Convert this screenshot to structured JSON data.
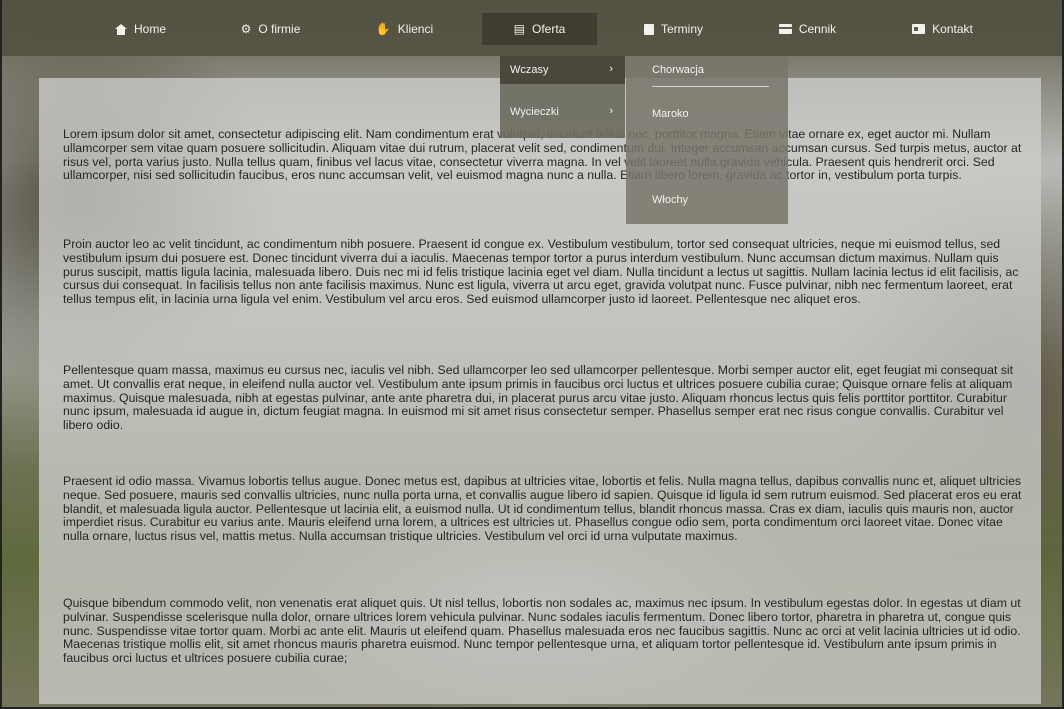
{
  "nav": {
    "items": [
      {
        "label": "Home",
        "icon": "home-icon"
      },
      {
        "label": "O firmie",
        "icon": "cogs-icon"
      },
      {
        "label": "Klienci",
        "icon": "handshake-icon"
      },
      {
        "label": "Oferta",
        "icon": "map-icon"
      },
      {
        "label": "Terminy",
        "icon": "calendar-icon"
      },
      {
        "label": "Cennik",
        "icon": "credit-card-icon"
      },
      {
        "label": "Kontakt",
        "icon": "id-card-icon"
      }
    ],
    "active": "Oferta"
  },
  "dropdown": {
    "level1": [
      {
        "label": "Wczasy",
        "arrow": "›",
        "selected": true
      },
      {
        "label": "Wycieczki",
        "arrow": "›",
        "selected": false
      }
    ],
    "level2": [
      "Chorwacja",
      "Maroko",
      "Włochy"
    ]
  },
  "content": {
    "paragraphs": [
      "Lorem ipsum dolor sit amet, consectetur adipiscing elit. Nam condimentum erat volutpat, tincidunt tellus nec, porttitor magna. Etiam vitae ornare ex, eget auctor mi. Nullam ullamcorper sem vitae quam posuere sollicitudin. Aliquam vitae dui rutrum, placerat velit sed, condimentum dui. Integer accumsan accumsan cursus. Sed turpis metus, auctor at risus vel, porta varius justo. Nulla tellus quam, finibus vel lacus vitae, consectetur viverra magna. In vel velit laoreet nulla gravida vehicula. Praesent quis hendrerit orci. Sed ullamcorper, nisi sed sollicitudin faucibus, eros nunc accumsan velit, vel euismod magna nunc a nulla. Etiam libero lorem, gravida ac tortor in, vestibulum porta turpis.",
      "Proin auctor leo ac velit tincidunt, ac condimentum nibh posuere. Praesent id congue ex. Vestibulum vestibulum, tortor sed consequat ultricies, neque mi euismod tellus, sed vestibulum ipsum dui posuere est. Donec tincidunt viverra dui a iaculis. Maecenas tempor tortor a purus interdum vestibulum. Nunc accumsan dictum maximus. Nullam quis purus suscipit, mattis ligula lacinia, malesuada libero. Duis nec mi id felis tristique lacinia eget vel diam. Nulla tincidunt a lectus ut sagittis. Nullam lacinia lectus id elit facilisis, ac cursus dui consequat. In facilisis tellus non ante facilisis maximus. Nunc est ligula, viverra ut arcu eget, gravida volutpat nunc. Fusce pulvinar, nibh nec fermentum laoreet, erat tellus tempus elit, in lacinia urna ligula vel enim. Vestibulum vel arcu eros. Sed euismod ullamcorper justo id laoreet. Pellentesque nec aliquet eros.",
      "Pellentesque quam massa, maximus eu cursus nec, iaculis vel nibh. Sed ullamcorper leo sed ullamcorper pellentesque. Morbi semper auctor elit, eget feugiat mi consequat sit amet. Ut convallis erat neque, in eleifend nulla auctor vel. Vestibulum ante ipsum primis in faucibus orci luctus et ultrices posuere cubilia curae; Quisque ornare felis at aliquam maximus. Quisque malesuada, nibh at egestas pulvinar, ante ante pharetra dui, in placerat purus arcu vitae justo. Aliquam rhoncus lectus quis felis porttitor porttitor. Curabitur nunc ipsum, malesuada id augue in, dictum feugiat magna. In euismod mi sit amet risus consectetur semper. Phasellus semper erat nec risus congue convallis. Curabitur vel libero odio.",
      "Praesent id odio massa. Vivamus lobortis tellus augue. Donec metus est, dapibus at ultricies vitae, lobortis et felis. Nulla magna tellus, dapibus convallis nunc et, aliquet ultricies neque. Sed posuere, mauris sed convallis ultricies, nunc nulla porta urna, et convallis augue libero id sapien. Quisque id ligula id sem rutrum euismod. Sed placerat eros eu erat blandit, et malesuada ligula auctor. Pellentesque ut lacinia elit, a euismod nulla. Ut id condimentum tellus, blandit rhoncus massa. Cras ex diam, iaculis quis mauris non, auctor imperdiet risus. Curabitur eu varius ante. Mauris eleifend urna lorem, a ultrices est ultricies ut. Phasellus congue odio sem, porta condimentum orci laoreet vitae. Donec vitae nulla ornare, luctus risus vel, mattis metus. Nulla accumsan tristique ultricies. Vestibulum vel orci id urna vulputate maximus.",
      "Quisque bibendum commodo velit, non venenatis erat aliquet quis. Ut nisl tellus, lobortis non sodales ac, maximus nec ipsum. In vestibulum egestas dolor. In egestas ut diam ut pulvinar. Suspendisse scelerisque nulla dolor, ornare ultrices lorem vehicula pulvinar. Nunc sodales iaculis fermentum. Donec libero tortor, pharetra in pharetra ut, congue quis nunc. Suspendisse vitae tortor quam. Morbi ac ante elit. Mauris ut eleifend quam. Phasellus malesuada eros nec faucibus sagittis. Nunc ac orci at velit lacinia ultricies ut id odio. Maecenas tristique mollis elit, sit amet rhoncus mauris pharetra euismod. Nunc tempor pellentesque urna, et aliquam tortor pellentesque id. Vestibulum ante ipsum primis in faucibus orci luctus et ultrices posuere cubilia curae;"
    ]
  }
}
